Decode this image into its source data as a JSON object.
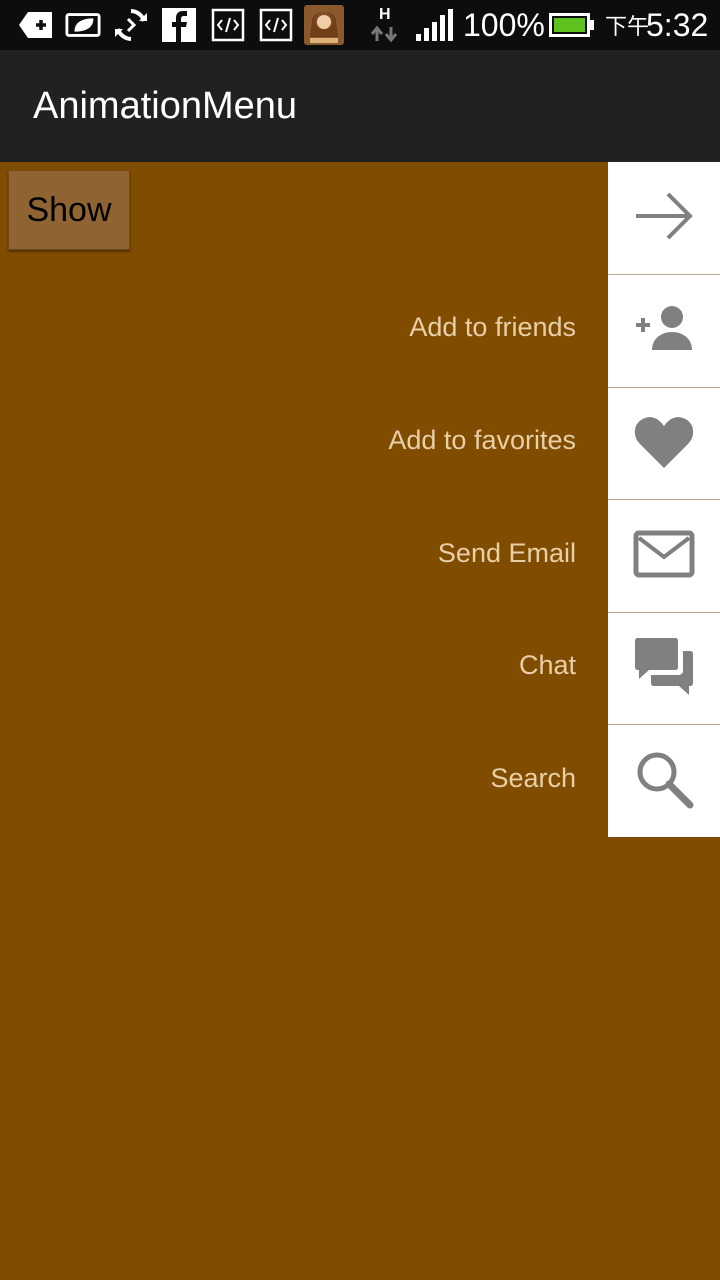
{
  "status_bar": {
    "battery_percent": "100%",
    "time_prefix": "下午",
    "time": "5:32",
    "network_type": "H",
    "icons": [
      "add-icon",
      "leaf-icon",
      "sync-icon",
      "facebook-icon",
      "code-icon",
      "code-icon",
      "app-avatar-icon",
      "data-transfer-icon",
      "signal-icon",
      "battery-icon"
    ],
    "battery_color": "#5fc11d"
  },
  "app": {
    "title": "AnimationMenu"
  },
  "show_button": {
    "label": "Show"
  },
  "menu": {
    "label_color": "#e9cfa8",
    "icon_color": "#808080",
    "items": [
      {
        "label": "",
        "icon": "arrow-right-icon"
      },
      {
        "label": "Add to friends",
        "icon": "add-person-icon"
      },
      {
        "label": "Add to favorites",
        "icon": "heart-icon"
      },
      {
        "label": "Send Email",
        "icon": "envelope-icon"
      },
      {
        "label": "Chat",
        "icon": "chat-icon"
      },
      {
        "label": "Search",
        "icon": "search-icon"
      }
    ]
  },
  "colors": {
    "background": "#804c00",
    "action_bar": "#212121",
    "status_bar": "#0d0d0d",
    "button": "#8f6432"
  }
}
